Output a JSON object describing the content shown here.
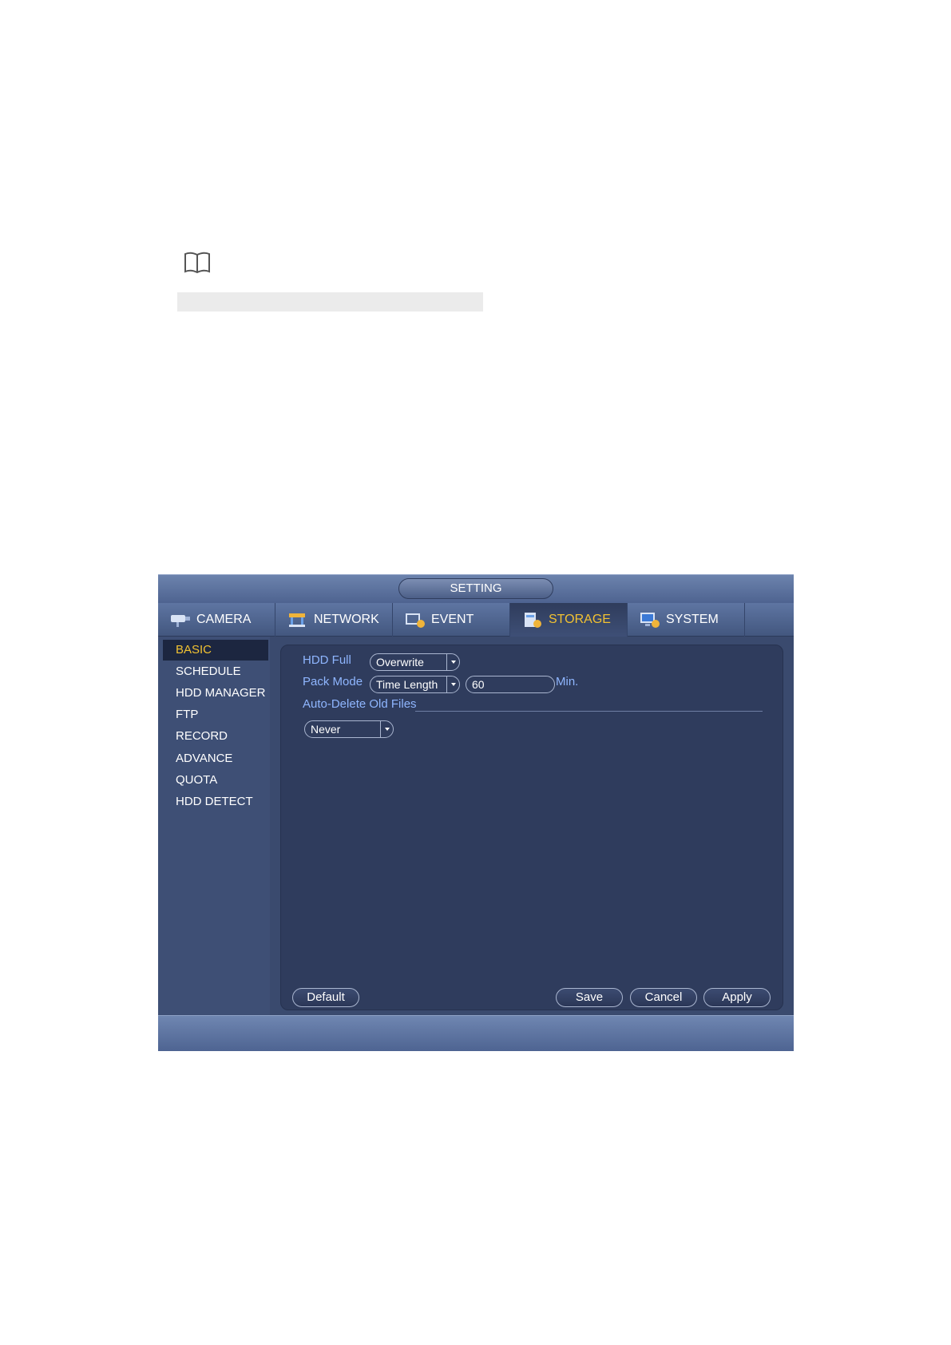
{
  "window": {
    "title": "SETTING"
  },
  "tabs": [
    {
      "label": "CAMERA",
      "icon": "camera-icon"
    },
    {
      "label": "NETWORK",
      "icon": "network-icon"
    },
    {
      "label": "EVENT",
      "icon": "event-icon"
    },
    {
      "label": "STORAGE",
      "icon": "storage-icon",
      "active": true
    },
    {
      "label": "SYSTEM",
      "icon": "system-icon"
    }
  ],
  "sidebar": {
    "items": [
      {
        "label": "BASIC",
        "active": true
      },
      {
        "label": "SCHEDULE"
      },
      {
        "label": "HDD MANAGER"
      },
      {
        "label": "FTP"
      },
      {
        "label": "RECORD"
      },
      {
        "label": "ADVANCE"
      },
      {
        "label": "QUOTA"
      },
      {
        "label": "HDD DETECT"
      }
    ]
  },
  "form": {
    "hdd_full": {
      "label": "HDD Full",
      "value": "Overwrite"
    },
    "pack_mode": {
      "label": "Pack Mode",
      "value": "Time Length",
      "length": "60",
      "unit": "Min."
    },
    "auto_delete": {
      "label": "Auto-Delete Old Files",
      "value": "Never"
    }
  },
  "buttons": {
    "default": "Default",
    "save": "Save",
    "cancel": "Cancel",
    "apply": "Apply"
  },
  "colors": {
    "accent_active": "#f2c232",
    "label_blue": "#8fb6ff",
    "panel": "#2f3c5d"
  }
}
